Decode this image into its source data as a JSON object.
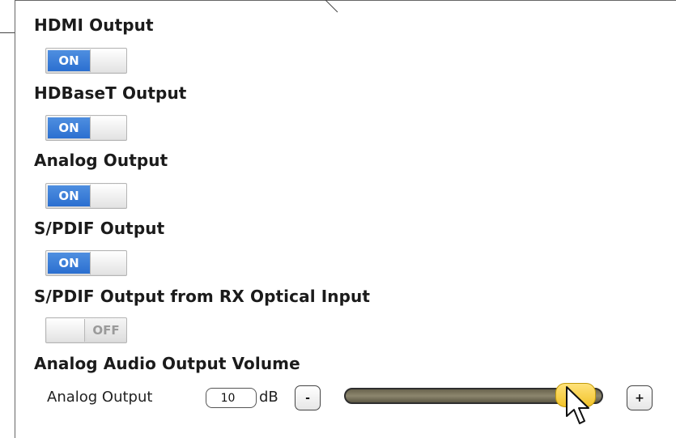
{
  "sections": [
    {
      "heading": "HDMI Output",
      "state": "ON"
    },
    {
      "heading": "HDBaseT Output",
      "state": "ON"
    },
    {
      "heading": "Analog Output",
      "state": "ON"
    },
    {
      "heading": "S/PDIF Output",
      "state": "ON"
    },
    {
      "heading": "S/PDIF Output from RX Optical Input",
      "state": "OFF"
    }
  ],
  "volume": {
    "heading": "Analog Audio Output Volume",
    "label": "Analog Output",
    "value": "10",
    "unit": "dB",
    "decrement_label": "-",
    "increment_label": "+",
    "slider_level_percent": 90
  },
  "colors": {
    "toggle_on": "#2b6fd0",
    "slider_thumb": "#f2c32a",
    "slider_track": "#7a745c"
  }
}
